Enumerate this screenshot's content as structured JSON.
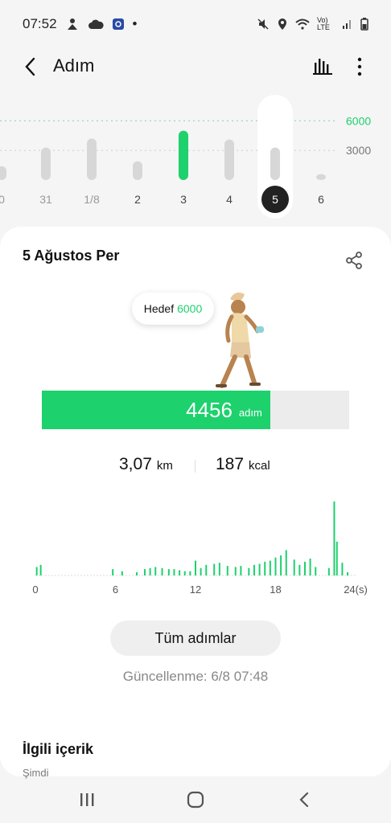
{
  "status": {
    "time": "07:52",
    "dot": "•",
    "lte": "Vo) LTE"
  },
  "header": {
    "title": "Adım"
  },
  "week": {
    "days": [
      "0",
      "31",
      "1/8",
      "2",
      "3",
      "4",
      "5",
      "6"
    ],
    "values": [
      1400,
      3300,
      4200,
      1900,
      5000,
      4100,
      3300,
      600
    ],
    "max": 7000,
    "goal_label": "6000",
    "mid_label": "3000",
    "selected_day": "5"
  },
  "detail": {
    "date": "5 Ağustos Per",
    "goal_prefix": "Hedef",
    "goal_value": "6000",
    "steps": "4456",
    "steps_unit": "adım",
    "progress": 0.743,
    "distance": "3,07",
    "distance_unit": "km",
    "calories": "187",
    "calories_unit": "kcal"
  },
  "chart_data": {
    "type": "bar",
    "x": [
      0,
      1,
      2,
      3,
      4,
      5,
      6,
      7,
      8,
      9,
      10,
      11,
      12,
      13,
      14,
      15,
      16,
      17,
      18,
      19,
      20,
      21,
      22,
      23
    ],
    "xticks": [
      "0",
      "6",
      "12",
      "18",
      "24(s)"
    ],
    "bars": [
      [
        0.1,
        8
      ],
      [
        0.4,
        10
      ],
      [
        5.8,
        6
      ],
      [
        6.5,
        4
      ],
      [
        7.6,
        3
      ],
      [
        8.2,
        6
      ],
      [
        8.6,
        7
      ],
      [
        9.0,
        8
      ],
      [
        9.5,
        7
      ],
      [
        10.0,
        6
      ],
      [
        10.4,
        6
      ],
      [
        10.8,
        5
      ],
      [
        11.2,
        4
      ],
      [
        11.6,
        4
      ],
      [
        12.0,
        14
      ],
      [
        12.4,
        7
      ],
      [
        12.8,
        10
      ],
      [
        13.4,
        11
      ],
      [
        13.8,
        12
      ],
      [
        14.4,
        9
      ],
      [
        15.0,
        8
      ],
      [
        15.4,
        9
      ],
      [
        16.0,
        7
      ],
      [
        16.4,
        10
      ],
      [
        16.8,
        11
      ],
      [
        17.2,
        13
      ],
      [
        17.6,
        14
      ],
      [
        18.0,
        17
      ],
      [
        18.4,
        19
      ],
      [
        18.8,
        24
      ],
      [
        19.4,
        15
      ],
      [
        19.8,
        10
      ],
      [
        20.2,
        13
      ],
      [
        20.6,
        16
      ],
      [
        21.0,
        8
      ],
      [
        22.0,
        7
      ],
      [
        22.4,
        70
      ],
      [
        22.6,
        32
      ],
      [
        23.0,
        12
      ],
      [
        23.4,
        3
      ]
    ],
    "ylim": [
      0,
      70
    ]
  },
  "actions": {
    "all_steps": "Tüm adımlar",
    "updated": "Güncellenme: 6/8 07:48"
  },
  "related": {
    "title": "İlgili içerik",
    "subtitle": "Şimdi"
  },
  "colors": {
    "accent": "#1dd16d",
    "bar_grey": "#d7d7d7"
  }
}
